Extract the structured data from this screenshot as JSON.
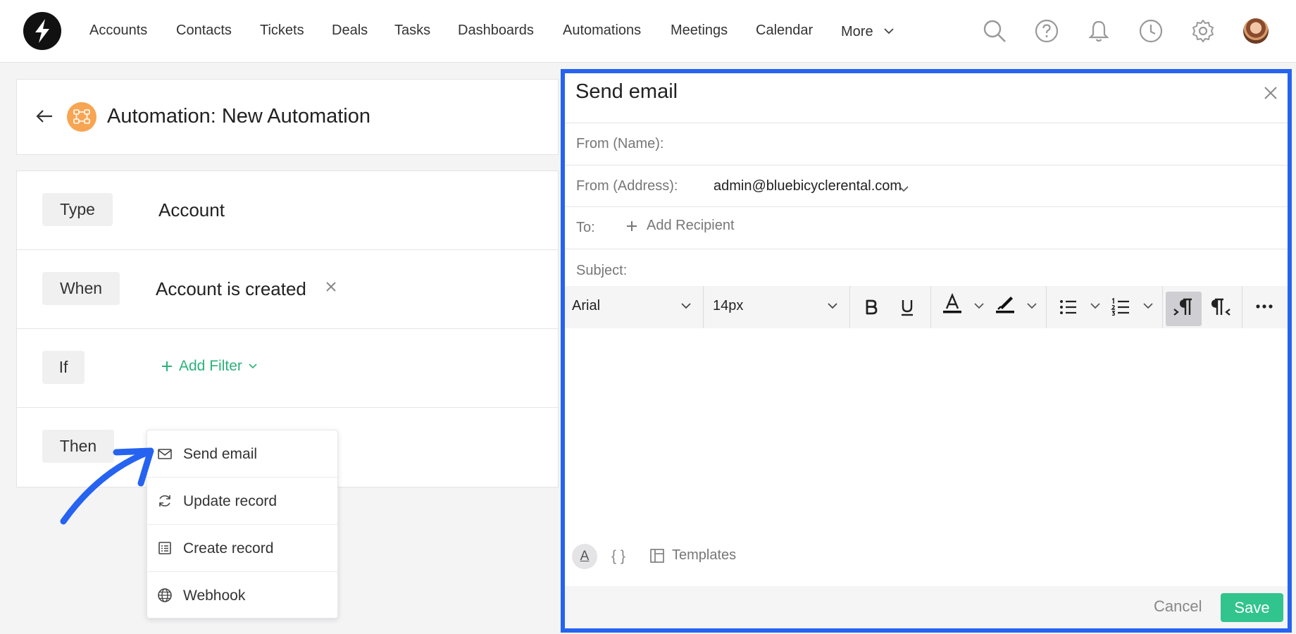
{
  "nav": {
    "items": [
      "Accounts",
      "Contacts",
      "Tickets",
      "Deals",
      "Tasks",
      "Dashboards",
      "Automations",
      "Meetings",
      "Calendar",
      "More"
    ]
  },
  "header": {
    "title": "Automation: New Automation"
  },
  "rules": {
    "type": {
      "label": "Type",
      "value": "Account"
    },
    "when": {
      "label": "When",
      "value": "Account is created"
    },
    "if": {
      "label": "If",
      "add_filter": "Add Filter"
    },
    "then": {
      "label": "Then"
    }
  },
  "action_menu": {
    "items": [
      {
        "label": "Send email",
        "icon": "mail-icon"
      },
      {
        "label": "Update record",
        "icon": "refresh-icon"
      },
      {
        "label": "Create record",
        "icon": "form-icon"
      },
      {
        "label": "Webhook",
        "icon": "globe-icon"
      }
    ]
  },
  "email": {
    "title": "Send email",
    "from_name_label": "From (Name):",
    "from_address_label": "From (Address):",
    "from_address_value": "admin@bluebicyclerental.com",
    "to_label": "To:",
    "add_recipient": "Add Recipient",
    "subject_label": "Subject:",
    "font": "Arial",
    "font_size": "14px",
    "braces": "{ }",
    "text_style_glyph": "A",
    "templates": "Templates",
    "cancel": "Cancel",
    "save": "Save"
  },
  "colors": {
    "accent_green": "#2bb27a",
    "save_green": "#31c48d",
    "panel_border_blue": "#2563f0",
    "automation_orange": "#f7a552"
  }
}
